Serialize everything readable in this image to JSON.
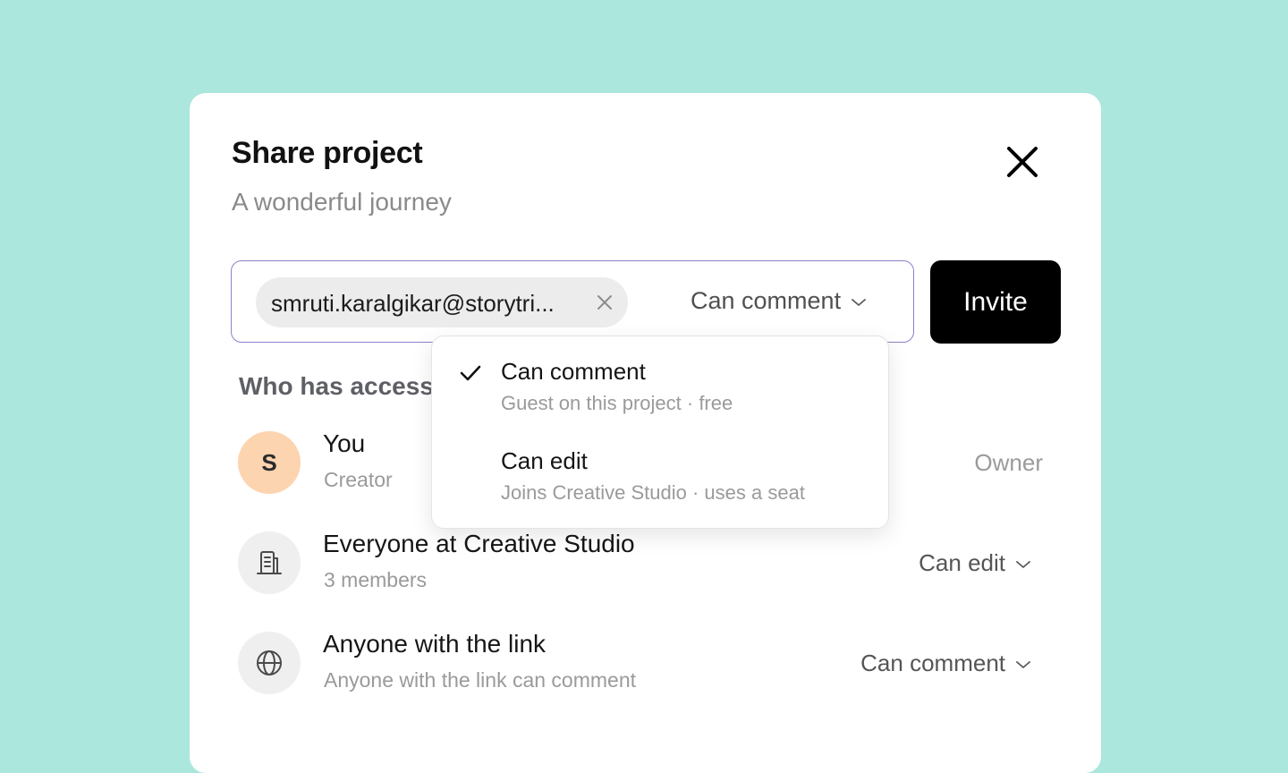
{
  "dialog": {
    "title": "Share project",
    "subtitle": "A wonderful journey"
  },
  "invite": {
    "chip_email": "smruti.karalgikar@storytri...",
    "role": "Can comment",
    "button_label": "Invite"
  },
  "access": {
    "section_label": "Who has access",
    "rows": [
      {
        "avatar": "S",
        "name": "You",
        "sub": "Creator",
        "role": "Owner"
      },
      {
        "icon": "building-icon",
        "name": "Everyone at Creative Studio",
        "sub": "3 members",
        "role": "Can edit"
      },
      {
        "icon": "globe-icon",
        "name": "Anyone with the link",
        "sub": "Anyone with the link can comment",
        "role": "Can comment"
      }
    ]
  },
  "role_menu": {
    "options": [
      {
        "label": "Can comment",
        "desc": "Guest on this project · free",
        "selected": true
      },
      {
        "label": "Can edit",
        "desc": "Joins Creative Studio · uses a seat",
        "selected": false
      }
    ]
  },
  "colors": {
    "background": "#abe7dc",
    "input_focus_border": "#8b80c9",
    "primary_button": "#000000",
    "user_avatar": "#fdd4b0"
  }
}
